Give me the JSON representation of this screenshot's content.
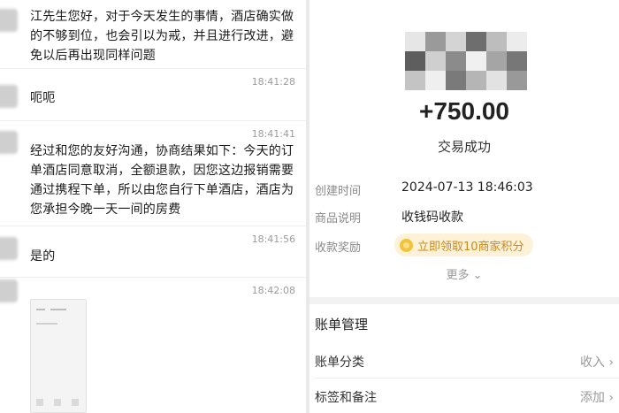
{
  "chat": {
    "messages": [
      {
        "text_lines": [
          "江先生您好，对于今天发生的事情，酒店确实做",
          "的不够到位，也会引以为戒，并且进行改进，避",
          "免以后再出现同样问题"
        ]
      },
      {
        "time": "18:41:28",
        "text_lines": [
          "呃呃"
        ]
      },
      {
        "time": "18:41:41",
        "text_lines": [
          "经过和您的友好沟通，协商结果如下：今天的订",
          "单酒店同意取消，全额退款，因您这边报销需要",
          "通过携程下单，所以由您自行下单酒店，酒店为",
          "您承担今晚一天一间的房费"
        ]
      },
      {
        "time": "18:41:56",
        "text_lines": [
          "是的"
        ]
      },
      {
        "time": "18:42:08",
        "text_lines": []
      }
    ]
  },
  "payment": {
    "amount": "+750.00",
    "status": "交易成功",
    "details": [
      {
        "label": "创建时间",
        "value": "2024-07-13 18:46:03"
      },
      {
        "label": "商品说明",
        "value": "收钱码收款"
      },
      {
        "label": "收款奖励",
        "value": ""
      }
    ],
    "reward_text": "立即领取10商家积分",
    "more_label": "更多",
    "more_chevron": "⌄",
    "section_title": "账单管理",
    "management": [
      {
        "label": "账单分类",
        "value": "收入 ›"
      },
      {
        "label": "标签和备注",
        "value": "添加 ›"
      }
    ]
  }
}
